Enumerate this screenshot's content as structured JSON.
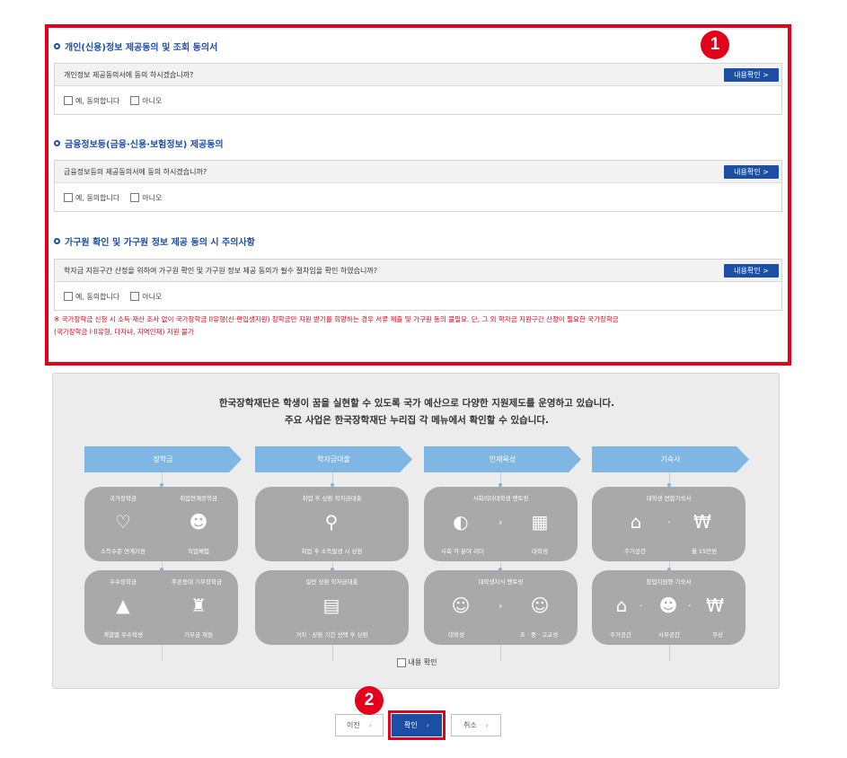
{
  "consent": {
    "sections": [
      {
        "title": "개인(신용)정보 제공동의 및 조회 동의서",
        "question": "개인정보 제공동의서에 동의 하시겠습니까?",
        "view_label": "내용확인 >",
        "yes_label": "예, 동의합니다",
        "no_label": "아니오"
      },
      {
        "title": "금융정보등(금융·신용·보험정보) 제공동의",
        "question": "금융정보등의 제공동의서에 동의 하시겠습니까?",
        "view_label": "내용확인 >",
        "yes_label": "예, 동의합니다",
        "no_label": "아니오"
      },
      {
        "title": "가구원 확인 및 가구원 정보 제공 동의 시 주의사항",
        "question": "학자금 지원구간 산정을 위하여 가구원 확인 및 가구원 정보 제공 동의가 필수 절차임을 확인 하였습니까?",
        "view_label": "내용확인 >",
        "yes_label": "예, 동의합니다",
        "no_label": "아니오"
      }
    ],
    "note_line1": "※ 국가장학금 신청 시 소득·재산 조사 없이 국가장학금 II유형(신·편입생지원) 장학금만 지원 받기를 희망하는 경우 서류 제출 및 가구원 동의 불필요. 단, 그 외 학자금 지원구간 산정이 필요한 국가장학금",
    "note_line2": "(국가장학금 I·II유형, 다자녀, 지역인재) 지원 불가"
  },
  "badges": {
    "one": "1",
    "two": "2"
  },
  "info": {
    "line1": "한국장학재단은 학생이 꿈을 실현할 수 있도록 국가 예산으로 다양한 지원제도를 운영하고 있습니다.",
    "line2": "주요 사업은 한국장학재단 누리집 각 메뉴에서 확인할 수 있습니다.",
    "categories": [
      "장학금",
      "학자금대출",
      "인재육성",
      "기숙사"
    ],
    "cards": {
      "c1": {
        "t1": "국가장학금",
        "t2": "취업연계장학금",
        "b1": "소득수준 연계지원",
        "b2": "직업체험"
      },
      "c2": {
        "t1": "취업 후 상환 학자금대출",
        "b1": "취업 후 소득발생 시 상환"
      },
      "c3": {
        "t1": "사회리더대학생 멘토링",
        "b1": "사회 각 분야 리더",
        "b2": "대학생"
      },
      "c4": {
        "t1": "대학생 연합기숙사",
        "b1": "주거공간",
        "b2": "월 15만원"
      },
      "c5": {
        "t1": "우수장학금",
        "t2": "푸른등대 기부장학금",
        "b1": "계열별 우수학생",
        "b2": "기부금 재원"
      },
      "c6": {
        "t1": "일반 상환 학자금대출",
        "b1": "거치 · 상환 기간 선택 후 상환"
      },
      "c7": {
        "t1": "대학생지식 멘토링",
        "b1": "대학생",
        "b2": "초 · 중 · 고교생"
      },
      "c8": {
        "t1": "창업지원형 기숙사",
        "b1": "주거공간",
        "b2": "사무공간",
        "b3": "무상"
      }
    },
    "confirm_label": "내용 확인"
  },
  "buttons": {
    "prev": "이전",
    "ok": "확인",
    "cancel": "취소"
  },
  "colors": {
    "accent": "#1c4fa4",
    "highlight": "#e2001a",
    "arrow": "#7fb6e3",
    "card": "#a9a9a9"
  }
}
